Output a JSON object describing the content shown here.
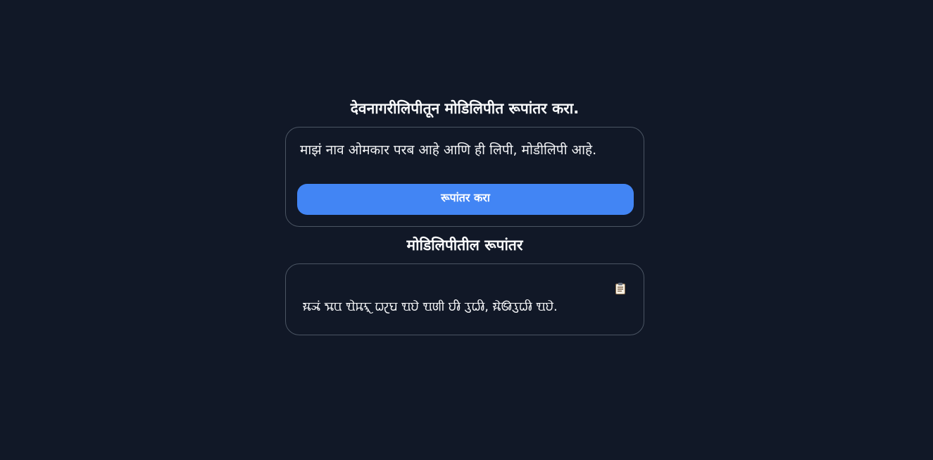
{
  "input_section": {
    "title": "देवनागरीलिपीतून मोडिलिपीत रूपांतर करा.",
    "input_value": "माझं नाव ओमकार परब आहे आणि ही लिपी, मोडीलिपी आहे.",
    "convert_label": "रूपांतर करा"
  },
  "output_section": {
    "title": "मोडिलिपीतील रूपांतर",
    "output_text": "𑘦𑘰𑘗𑘽 𑘡𑘰𑘪 𑘌𑘦𑘎𑘰𑘨 𑘢𑘨𑘤 𑘁𑘮𑘹 𑘁𑘜𑘱 𑘮𑘲 𑘩𑘱𑘢𑘲, 𑘦𑘻𑘚𑘲𑘩𑘱𑘢𑘲 𑘁𑘮𑘹.",
    "copy_icon": "clipboard-icon"
  },
  "colors": {
    "background": "#111827",
    "card_border": "#4b5563",
    "button": "#4285f4",
    "text": "#f3f4f6"
  }
}
